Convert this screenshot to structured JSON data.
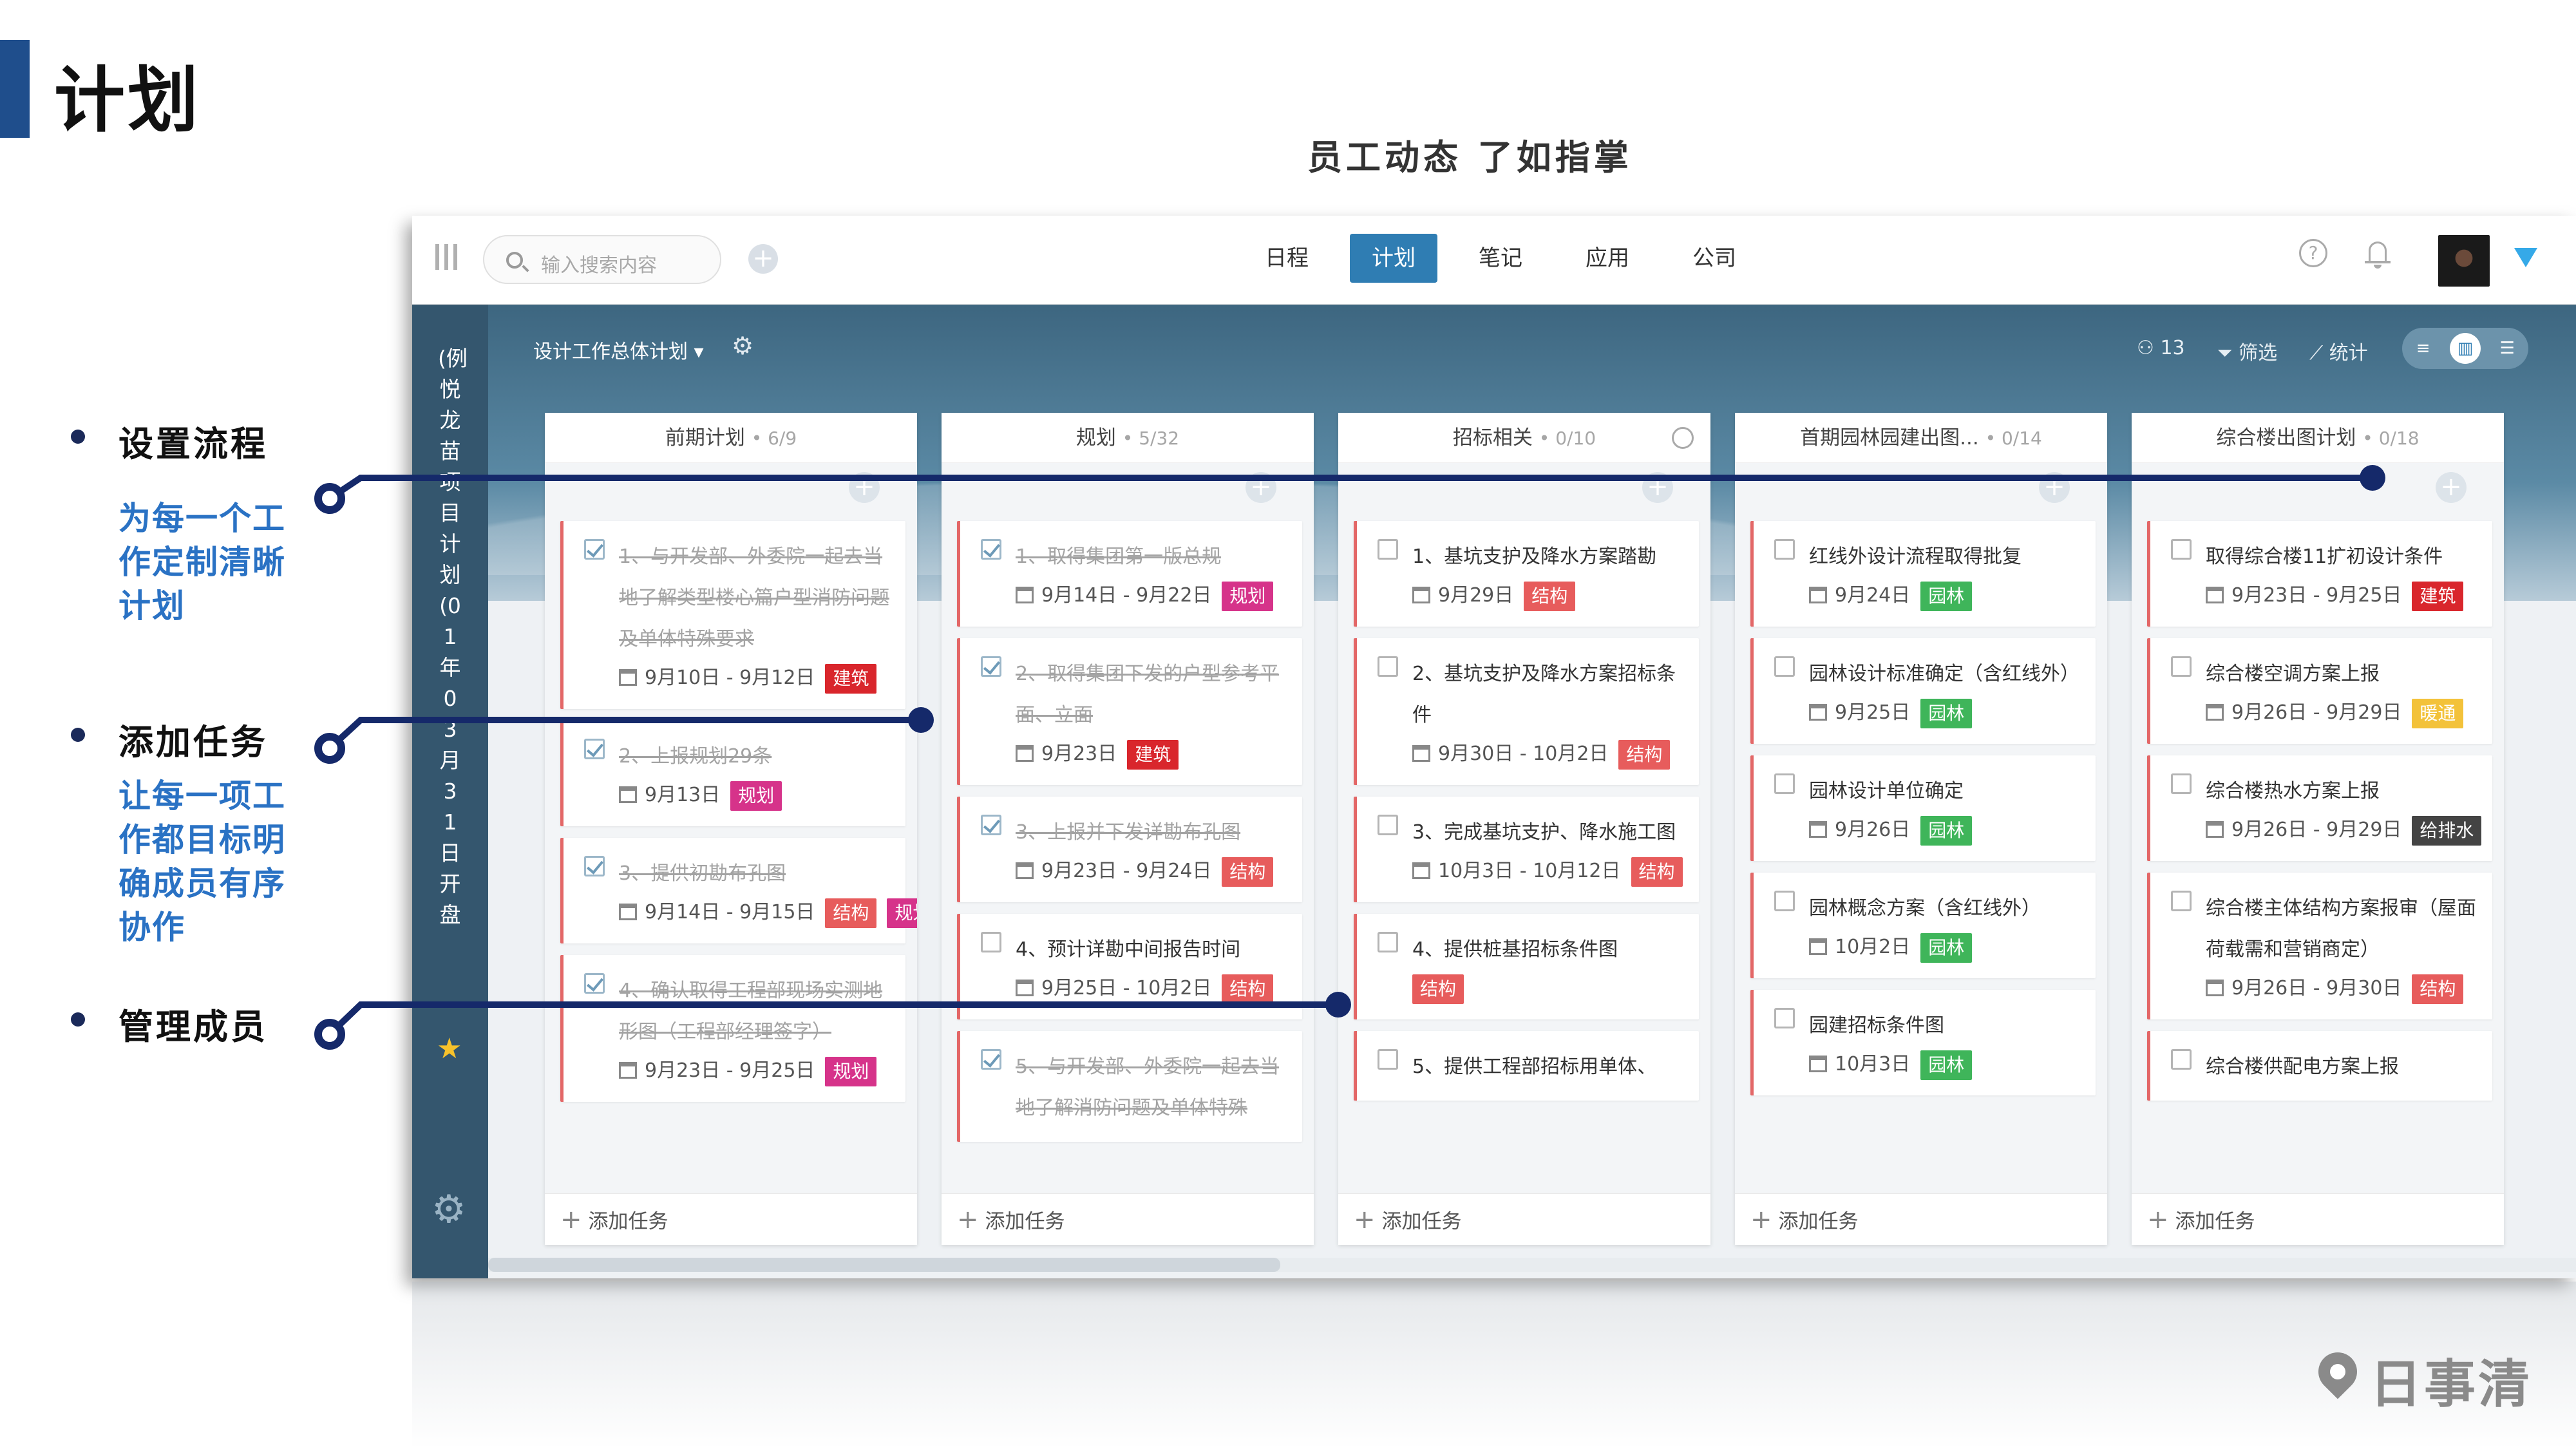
{
  "slide": {
    "title": "计划",
    "subtitle": "员工动态 了如指掌"
  },
  "features": [
    {
      "title": "设置流程",
      "desc": "为每一个工作定制清晰计划"
    },
    {
      "title": "添加任务",
      "desc": "让每一项工作都目标明确成员有序协作"
    },
    {
      "title": "管理成员",
      "desc": ""
    }
  ],
  "topbar": {
    "search_placeholder": "输入搜索内容",
    "nav": [
      "日程",
      "计划",
      "笔记",
      "应用",
      "公司"
    ],
    "active_nav": "计划"
  },
  "sidebar": {
    "project_name": "(例悦龙苗项目计划(01年03月31日开盘"
  },
  "board": {
    "plan_name": "设计工作总体计划 ▾",
    "members": "13",
    "filter_label": "筛选",
    "stats_label": "统计",
    "add_task_label": "添加任务",
    "columns": [
      {
        "name": "前期计划",
        "count": "• 6/9",
        "cards": [
          {
            "title": "1、与开发部、外委院一起去当地了解类型楼心篇户型消防问题及单体特殊要求",
            "date": "9月10日 - 9月12日",
            "tags": [
              "建筑"
            ],
            "done": true
          },
          {
            "title": "2、上报规划29条",
            "date": "9月13日",
            "tags": [
              "规划"
            ],
            "done": true
          },
          {
            "title": "3、提供初勘布孔图",
            "date": "9月14日 - 9月15日",
            "tags": [
              "结构",
              "规划"
            ],
            "done": true
          },
          {
            "title": "4、确认取得工程部现场实测地形图（工程部经理签字）",
            "date": "9月23日 - 9月25日",
            "tags": [
              "规划"
            ],
            "done": true
          }
        ]
      },
      {
        "name": "规划",
        "count": "• 5/32",
        "cards": [
          {
            "title": "1、取得集团第一版总规",
            "date": "9月14日 - 9月22日",
            "tags": [
              "规划"
            ],
            "done": true
          },
          {
            "title": "2、取得集团下发的户型参考平面、立面",
            "date": "9月23日",
            "tags": [
              "建筑"
            ],
            "done": true
          },
          {
            "title": "3、上报并下发详勘布孔图",
            "date": "9月23日 - 9月24日",
            "tags": [
              "结构"
            ],
            "done": true
          },
          {
            "title": "4、预计详勘中间报告时间",
            "date": "9月25日 - 10月2日",
            "tags": [
              "结构"
            ],
            "done": false
          },
          {
            "title": "5、与开发部、外委院一起去当地了解消防问题及单体特殊",
            "date": "",
            "tags": [],
            "done": true
          }
        ]
      },
      {
        "name": "招标相关",
        "count": "• 0/10",
        "cards": [
          {
            "title": "1、基坑支护及降水方案踏勘",
            "date": "9月29日",
            "tags": [
              "结构"
            ],
            "done": false
          },
          {
            "title": "2、基坑支护及降水方案招标条件",
            "date": "9月30日 - 10月2日",
            "tags": [
              "结构"
            ],
            "done": false
          },
          {
            "title": "3、完成基坑支护、降水施工图",
            "date": "10月3日 - 10月12日",
            "tags": [
              "结构"
            ],
            "done": false
          },
          {
            "title": "4、提供桩基招标条件图",
            "date": "",
            "tags": [
              "结构"
            ],
            "done": false
          },
          {
            "title": "5、提供工程部招标用单体、",
            "date": "",
            "tags": [],
            "done": false
          }
        ]
      },
      {
        "name": "首期园林园建出图...",
        "count": "• 0/14",
        "cards": [
          {
            "title": "红线外设计流程取得批复",
            "date": "9月24日",
            "tags": [
              "园林"
            ],
            "done": false
          },
          {
            "title": "园林设计标准确定（含红线外）",
            "date": "9月25日",
            "tags": [
              "园林"
            ],
            "done": false
          },
          {
            "title": "园林设计单位确定",
            "date": "9月26日",
            "tags": [
              "园林"
            ],
            "done": false
          },
          {
            "title": "园林概念方案（含红线外）",
            "date": "10月2日",
            "tags": [
              "园林"
            ],
            "done": false
          },
          {
            "title": "园建招标条件图",
            "date": "10月3日",
            "tags": [
              "园林"
            ],
            "done": false
          }
        ]
      },
      {
        "name": "综合楼出图计划",
        "count": "• 0/18",
        "cards": [
          {
            "title": "取得综合楼11扩初设计条件",
            "date": "9月23日 - 9月25日",
            "tags": [
              "建筑"
            ],
            "done": false
          },
          {
            "title": "综合楼空调方案上报",
            "date": "9月26日 - 9月29日",
            "tags": [
              "暖通"
            ],
            "done": false
          },
          {
            "title": "综合楼热水方案上报",
            "date": "9月26日 - 9月29日",
            "tags": [
              "给排水"
            ],
            "done": false
          },
          {
            "title": "综合楼主体结构方案报审（屋面荷载需和营销商定）",
            "date": "9月26日 - 9月30日",
            "tags": [
              "结构"
            ],
            "done": false
          },
          {
            "title": "综合楼供配电方案上报",
            "date": "",
            "tags": [],
            "done": false
          }
        ]
      }
    ]
  },
  "tag_colors": {
    "建筑": "#d9262c",
    "规划": "#d6338a",
    "结构": "#e75c5c",
    "园林": "#3fb55a",
    "暖通": "#f3c23a",
    "给排水": "#444444"
  },
  "brand": "日事清"
}
